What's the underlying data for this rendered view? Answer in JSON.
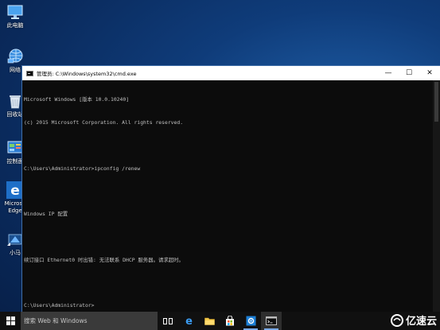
{
  "desktop": {
    "icons": [
      {
        "label": "此电脑",
        "icon": "computer-icon"
      },
      {
        "label": "网络",
        "icon": "network-icon"
      },
      {
        "label": "回收站",
        "icon": "recycle-bin-icon"
      },
      {
        "label": "控制面",
        "icon": "control-panel-icon"
      },
      {
        "label": "Microsoft Edge",
        "label_line1": "Microso",
        "label_line2": "Edge",
        "icon": "edge-icon"
      },
      {
        "label": "小马",
        "icon": "tool-shortcut-icon"
      }
    ]
  },
  "window": {
    "title": "管理员: C:\\Windows\\system32\\cmd.exe",
    "controls": {
      "minimize": "—",
      "maximize": "☐",
      "close": "✕"
    },
    "console_lines": [
      "Microsoft Windows [版本 10.0.10240]",
      "(c) 2015 Microsoft Corporation. All rights reserved.",
      "",
      "C:\\Users\\Administrator>ipconfig /renew",
      "",
      "Windows IP 配置",
      "",
      "续订接口 Ethernet0 时出错: 无法联系 DHCP 服务器。请求超时。",
      "",
      "C:\\Users\\Administrator>"
    ]
  },
  "taskbar": {
    "search_placeholder": "搜索 Web 和 Windows",
    "apps": [
      {
        "name": "task-view",
        "icon": "task-view-icon"
      },
      {
        "name": "edge",
        "icon": "edge-icon"
      },
      {
        "name": "file-explorer",
        "icon": "folder-icon"
      },
      {
        "name": "store",
        "icon": "store-icon"
      },
      {
        "name": "control-panel",
        "icon": "gear-app-icon"
      },
      {
        "name": "cmd",
        "icon": "cmd-icon",
        "active": true
      }
    ]
  },
  "watermark": {
    "text": "亿速云"
  },
  "colors": {
    "console_bg": "#0c0c0c",
    "console_text": "#c0c0c0",
    "taskbar_bg": "#101010",
    "search_bg": "#3a3a3a",
    "accent": "#0078d7"
  }
}
